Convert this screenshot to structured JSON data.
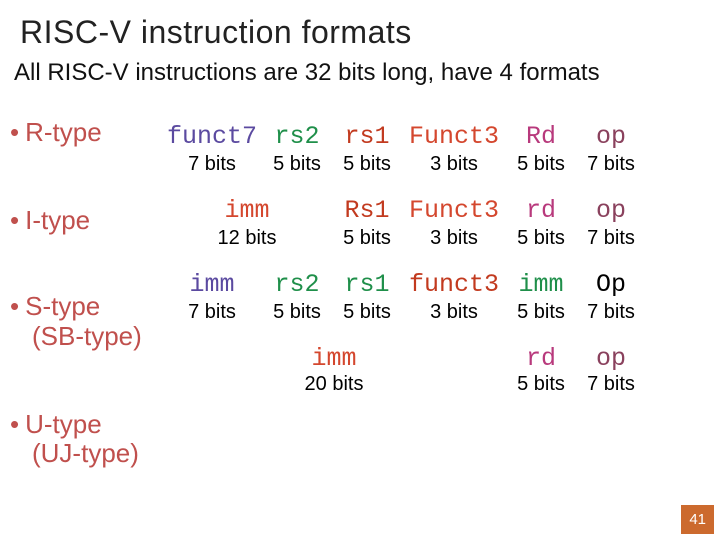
{
  "title": "RISC-V instruction formats",
  "subtitle": "All RISC-V instructions are 32 bits long, have 4 formats",
  "page_number": "41",
  "bullets": {
    "r": "R-type",
    "i": "I-type",
    "s_line1": "S-type",
    "s_line2": "(SB-type)",
    "u_line1": "U-type",
    "u_line2": "(UJ-type)"
  },
  "rtype": {
    "fields": {
      "funct7": "funct7",
      "rs2": "rs2",
      "rs1": "rs1",
      "funct3": "Funct3",
      "rd": "Rd",
      "op": "op"
    },
    "bits": {
      "funct7": "7 bits",
      "rs2": "5 bits",
      "rs1": "5 bits",
      "funct3": "3 bits",
      "rd": "5 bits",
      "op": "7 bits"
    }
  },
  "itype": {
    "fields": {
      "imm": "imm",
      "rs1": "Rs1",
      "funct3": "Funct3",
      "rd": "rd",
      "op": "op"
    },
    "bits": {
      "imm": "12 bits",
      "rs1": "5 bits",
      "funct3": "3 bits",
      "rd": "5 bits",
      "op": "7 bits"
    }
  },
  "stype": {
    "fields": {
      "imm7": "imm",
      "rs2": "rs2",
      "rs1": "rs1",
      "funct3": "funct3",
      "imm5": "imm",
      "op": "Op"
    },
    "bits": {
      "imm7": "7 bits",
      "rs2": "5 bits",
      "rs1": "5 bits",
      "funct3": "3 bits",
      "imm5": "5 bits",
      "op": "7 bits"
    }
  },
  "utype": {
    "fields": {
      "imm": "imm",
      "rd": "rd",
      "op": "op"
    },
    "bits": {
      "imm": "20 bits",
      "rd": "5 bits",
      "op": "7 bits"
    }
  }
}
